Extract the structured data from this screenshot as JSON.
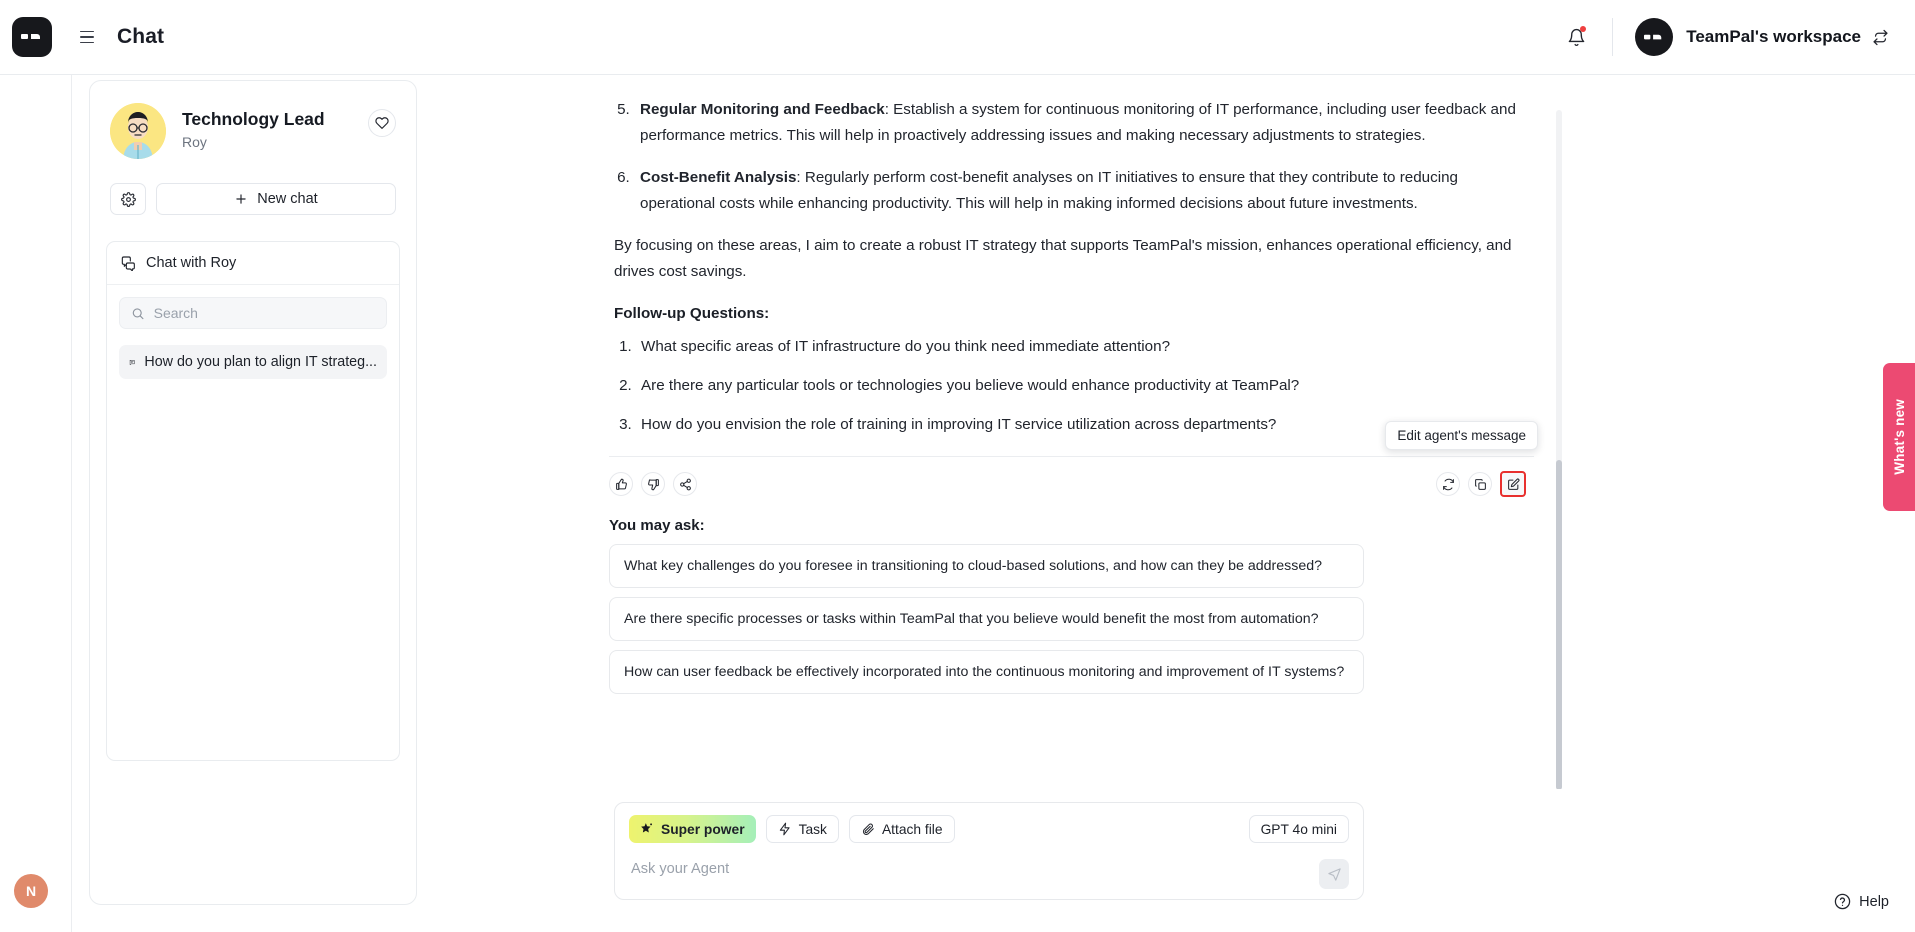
{
  "topbar": {
    "logo_icon": "teampal-logo-icon",
    "menu_icon": "hamburger-menu-icon",
    "title": "Chat",
    "notification_icon": "bell-icon",
    "workspace_name": "TeamPal's workspace",
    "workspace_switch_icon": "switch-workspace-icon"
  },
  "rail": {
    "user_initial": "N"
  },
  "sidebar": {
    "agent_name": "Technology Lead",
    "agent_role": "Roy",
    "favorite_icon": "heart-icon",
    "settings_icon": "gear-icon",
    "new_chat_label": "New chat",
    "new_chat_icon": "plus-icon",
    "chatlist_header": "Chat with Roy",
    "chatlist_header_icon": "chat-bubbles-icon",
    "search": {
      "placeholder": "Search",
      "value": "",
      "icon": "search-icon"
    },
    "chat_items": [
      {
        "icon": "chat-bubble-icon",
        "label": "How do you plan to align IT strateg..."
      }
    ]
  },
  "message": {
    "numbered_items": [
      {
        "number": "5.",
        "bold": "Regular Monitoring and Feedback",
        "text": ": Establish a system for continuous monitoring of IT performance, including user feedback and performance metrics. This will help in proactively addressing issues and making necessary adjustments to strategies."
      },
      {
        "number": "6.",
        "bold": "Cost-Benefit Analysis",
        "text": ": Regularly perform cost-benefit analyses on IT initiatives to ensure that they contribute to reducing operational costs while enhancing productivity. This will help in making informed decisions about future investments."
      }
    ],
    "closing_paragraph": "By focusing on these areas, I aim to create a robust IT strategy that supports TeamPal's mission, enhances operational efficiency, and drives cost savings.",
    "followup_heading": "Follow-up Questions:",
    "followup_questions": [
      "What specific areas of IT infrastructure do you think need immediate attention?",
      "Are there any particular tools or technologies you believe would enhance productivity at TeamPal?",
      "How do you envision the role of training in improving IT service utilization across departments?"
    ]
  },
  "actions": {
    "thumbs_up_icon": "thumbs-up-icon",
    "thumbs_down_icon": "thumbs-down-icon",
    "share_icon": "share-icon",
    "regenerate_icon": "regenerate-icon",
    "copy_icon": "copy-icon",
    "edit_icon": "edit-icon",
    "tooltip": "Edit agent's message",
    "highlight_color": "#e8302e"
  },
  "suggestions": {
    "title": "You may ask:",
    "items": [
      "What key challenges do you foresee in transitioning to cloud-based solutions, and how can they be addressed?",
      "Are there specific processes or tasks within TeamPal that you believe would benefit the most from automation?",
      "How can user feedback be effectively incorporated into the continuous monitoring and improvement of IT systems?"
    ]
  },
  "composer": {
    "super_power_label": "Super power",
    "super_power_icon": "star-icon",
    "task_label": "Task",
    "task_icon": "lightning-icon",
    "attach_label": "Attach file",
    "attach_icon": "paperclip-icon",
    "model_label": "GPT 4o mini",
    "input_placeholder": "Ask your Agent",
    "input_value": "",
    "send_icon": "send-icon"
  },
  "right_edge": {
    "whats_new_label": "What's new",
    "whats_new_color": "#ec4a72",
    "help_label": "Help",
    "help_icon": "question-circle-icon"
  }
}
